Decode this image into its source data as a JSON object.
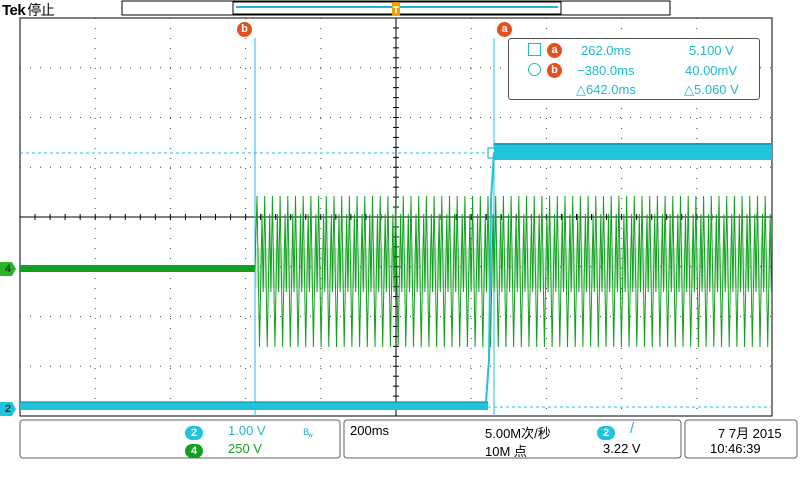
{
  "header": {
    "brand": "Tek",
    "status": "停止"
  },
  "cursors": {
    "a_badge": "a",
    "b_badge": "b"
  },
  "readout": {
    "a_time": "262.0ms",
    "a_value": "5.100 V",
    "b_time": "−380.0ms",
    "b_value": "40.00mV",
    "delta_time": "△642.0ms",
    "delta_value": "△5.060 V"
  },
  "channels": {
    "ch2_marker": "2",
    "ch4_marker": "4",
    "ch2_scale": "1.00 V",
    "ch4_scale": "250 V",
    "ch2_color": "#1fc3db",
    "ch4_color": "#12a020"
  },
  "timebase": {
    "scale": "200ms",
    "sample_rate": "5.00M次/秒",
    "record_length": "10M 点"
  },
  "trigger": {
    "source": "2",
    "slope": "/",
    "level": "3.22 V"
  },
  "datetime": {
    "date": "7 7月 2015",
    "time": "10:46:39"
  },
  "icons": {
    "bandwidth": "bandwidth-limit-icon",
    "trigger_slope": "rising-edge-icon",
    "trigger_marker": "trigger-position-icon"
  }
}
